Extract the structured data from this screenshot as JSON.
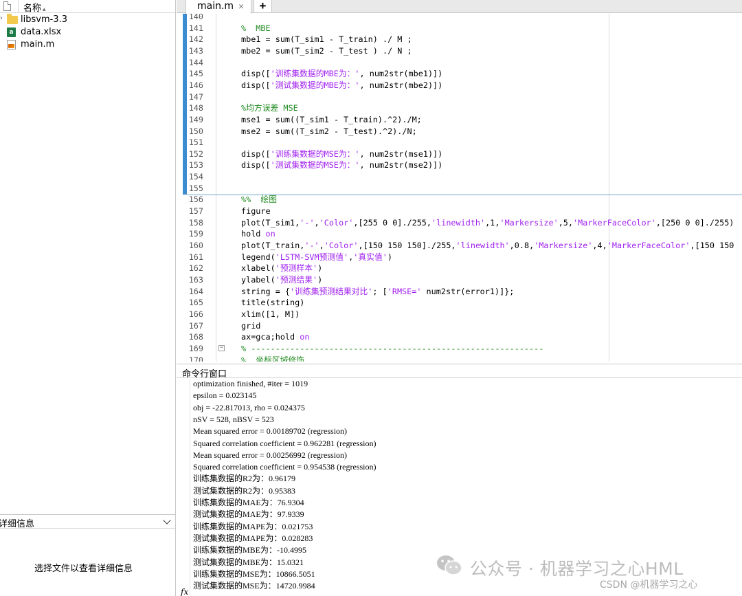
{
  "file_browser": {
    "column_name": "名称",
    "sort_indicator": "▴",
    "items": [
      {
        "name": "libsvm-3.3",
        "type": "folder"
      },
      {
        "name": "data.xlsx",
        "type": "xlsx",
        "icon_letter": "a"
      },
      {
        "name": "main.m",
        "type": "m"
      }
    ],
    "details_title": "详细信息",
    "details_message": "选择文件以查看详细信息"
  },
  "editor": {
    "tab_label": "main.m",
    "tab_close": "×",
    "tab_add": "+",
    "fold_marker": "−",
    "lines": [
      {
        "n": "140",
        "t": [
          {
            "k": "p",
            "s": ""
          }
        ]
      },
      {
        "n": "141",
        "t": [
          {
            "k": "com",
            "s": "%  MBE"
          }
        ]
      },
      {
        "n": "142",
        "t": [
          {
            "k": "p",
            "s": "mbe1 = sum(T_sim1 - T_train) ./ M ;"
          }
        ]
      },
      {
        "n": "143",
        "t": [
          {
            "k": "p",
            "s": "mbe2 = sum(T_sim2 - T_test ) ./ N ;"
          }
        ]
      },
      {
        "n": "144",
        "t": [
          {
            "k": "p",
            "s": ""
          }
        ]
      },
      {
        "n": "145",
        "t": [
          {
            "k": "p",
            "s": "disp(["
          },
          {
            "k": "str",
            "s": "'训练集数据的MBE为：'"
          },
          {
            "k": "p",
            "s": ", num2str(mbe1)])"
          }
        ]
      },
      {
        "n": "146",
        "t": [
          {
            "k": "p",
            "s": "disp(["
          },
          {
            "k": "str",
            "s": "'测试集数据的MBE为：'"
          },
          {
            "k": "p",
            "s": ", num2str(mbe2)])"
          }
        ]
      },
      {
        "n": "147",
        "t": [
          {
            "k": "p",
            "s": ""
          }
        ]
      },
      {
        "n": "148",
        "t": [
          {
            "k": "com",
            "s": "%均方误差 MSE"
          }
        ]
      },
      {
        "n": "149",
        "t": [
          {
            "k": "p",
            "s": "mse1 = sum((T_sim1 - T_train).^2)./M;"
          }
        ]
      },
      {
        "n": "150",
        "t": [
          {
            "k": "p",
            "s": "mse2 = sum((T_sim2 - T_test).^2)./N;"
          }
        ]
      },
      {
        "n": "151",
        "t": [
          {
            "k": "p",
            "s": ""
          }
        ]
      },
      {
        "n": "152",
        "t": [
          {
            "k": "p",
            "s": "disp(["
          },
          {
            "k": "str",
            "s": "'训练集数据的MSE为：'"
          },
          {
            "k": "p",
            "s": ", num2str(mse1)])"
          }
        ]
      },
      {
        "n": "153",
        "t": [
          {
            "k": "p",
            "s": "disp(["
          },
          {
            "k": "str",
            "s": "'测试集数据的MSE为：'"
          },
          {
            "k": "p",
            "s": ", num2str(mse2)])"
          }
        ]
      },
      {
        "n": "154",
        "t": [
          {
            "k": "p",
            "s": ""
          }
        ]
      },
      {
        "n": "155",
        "t": [
          {
            "k": "p",
            "s": ""
          }
        ]
      },
      {
        "n": "156",
        "t": [
          {
            "k": "com",
            "s": "%%  绘图"
          }
        ]
      },
      {
        "n": "157",
        "t": [
          {
            "k": "p",
            "s": "figure"
          }
        ]
      },
      {
        "n": "158",
        "t": [
          {
            "k": "p",
            "s": "plot(T_sim1,"
          },
          {
            "k": "str",
            "s": "'-'"
          },
          {
            "k": "p",
            "s": ","
          },
          {
            "k": "str",
            "s": "'Color'"
          },
          {
            "k": "p",
            "s": ",[255 0 0]./255,"
          },
          {
            "k": "str",
            "s": "'linewidth'"
          },
          {
            "k": "p",
            "s": ",1,"
          },
          {
            "k": "str",
            "s": "'Markersize'"
          },
          {
            "k": "p",
            "s": ",5,"
          },
          {
            "k": "str",
            "s": "'MarkerFaceColor'"
          },
          {
            "k": "p",
            "s": ",[250 0 0]./255)"
          }
        ]
      },
      {
        "n": "159",
        "t": [
          {
            "k": "p",
            "s": "hold "
          },
          {
            "k": "str",
            "s": "on"
          }
        ]
      },
      {
        "n": "160",
        "t": [
          {
            "k": "p",
            "s": "plot(T_train,"
          },
          {
            "k": "str",
            "s": "'-'"
          },
          {
            "k": "p",
            "s": ","
          },
          {
            "k": "str",
            "s": "'Color'"
          },
          {
            "k": "p",
            "s": ",[150 150 150]./255,"
          },
          {
            "k": "str",
            "s": "'linewidth'"
          },
          {
            "k": "p",
            "s": ",0.8,"
          },
          {
            "k": "str",
            "s": "'Markersize'"
          },
          {
            "k": "p",
            "s": ",4,"
          },
          {
            "k": "str",
            "s": "'MarkerFaceColor'"
          },
          {
            "k": "p",
            "s": ",[150 150"
          }
        ]
      },
      {
        "n": "161",
        "t": [
          {
            "k": "p",
            "s": "legend("
          },
          {
            "k": "str",
            "s": "'LSTM-SVM预测值'"
          },
          {
            "k": "p",
            "s": ","
          },
          {
            "k": "str",
            "s": "'真实值'"
          },
          {
            "k": "p",
            "s": ")"
          }
        ]
      },
      {
        "n": "162",
        "t": [
          {
            "k": "p",
            "s": "xlabel("
          },
          {
            "k": "str",
            "s": "'预测样本'"
          },
          {
            "k": "p",
            "s": ")"
          }
        ]
      },
      {
        "n": "163",
        "t": [
          {
            "k": "p",
            "s": "ylabel("
          },
          {
            "k": "str",
            "s": "'预测结果'"
          },
          {
            "k": "p",
            "s": ")"
          }
        ]
      },
      {
        "n": "164",
        "t": [
          {
            "k": "p",
            "s": "string = {"
          },
          {
            "k": "str",
            "s": "'训练集预测结果对比'"
          },
          {
            "k": "p",
            "s": "; ["
          },
          {
            "k": "str",
            "s": "'RMSE='"
          },
          {
            "k": "p",
            "s": " num2str(error1)]};"
          }
        ]
      },
      {
        "n": "165",
        "t": [
          {
            "k": "p",
            "s": "title(string)"
          }
        ]
      },
      {
        "n": "166",
        "t": [
          {
            "k": "p",
            "s": "xlim([1, M])"
          }
        ]
      },
      {
        "n": "167",
        "t": [
          {
            "k": "p",
            "s": "grid"
          }
        ]
      },
      {
        "n": "168",
        "t": [
          {
            "k": "p",
            "s": "ax=gca;hold "
          },
          {
            "k": "str",
            "s": "on"
          }
        ]
      },
      {
        "n": "169",
        "t": [
          {
            "k": "com",
            "s": "% ------------------------------------------------------------"
          }
        ],
        "fold": true
      },
      {
        "n": "170",
        "t": [
          {
            "k": "com",
            "s": "%  坐标区域修饰"
          }
        ]
      }
    ]
  },
  "command_window": {
    "title": "命令行窗口",
    "prompt": "fx",
    "lines": [
      "optimization finished, #iter = 1019",
      "epsilon = 0.023145",
      "obj = -22.817013, rho = 0.024375",
      "nSV = 528, nBSV = 523",
      "Mean squared error = 0.00189702 (regression)",
      "Squared correlation coefficient = 0.962281 (regression)",
      "Mean squared error = 0.00256992 (regression)",
      "Squared correlation coefficient = 0.954538 (regression)",
      "训练集数据的R2为：0.96179",
      "测试集数据的R2为：0.95383",
      "训练集数据的MAE为：76.9304",
      "测试集数据的MAE为：97.9339",
      "训练集数据的MAPE为：0.021753",
      "测试集数据的MAPE为：0.028283",
      "训练集数据的MBE为：-10.4995",
      "测试集数据的MBE为：15.0321",
      "训练集数据的MSE为：10866.5051",
      "测试集数据的MSE为：14720.9984"
    ]
  },
  "watermark": {
    "main": "公众号 · 机器学习之心HML",
    "csdn": "CSDN @机器学习之心"
  },
  "colors": {
    "string": "#a020f0",
    "comment": "#228b22",
    "keyword": "#0000ff",
    "gutter_bar": "#3c8ccf"
  }
}
